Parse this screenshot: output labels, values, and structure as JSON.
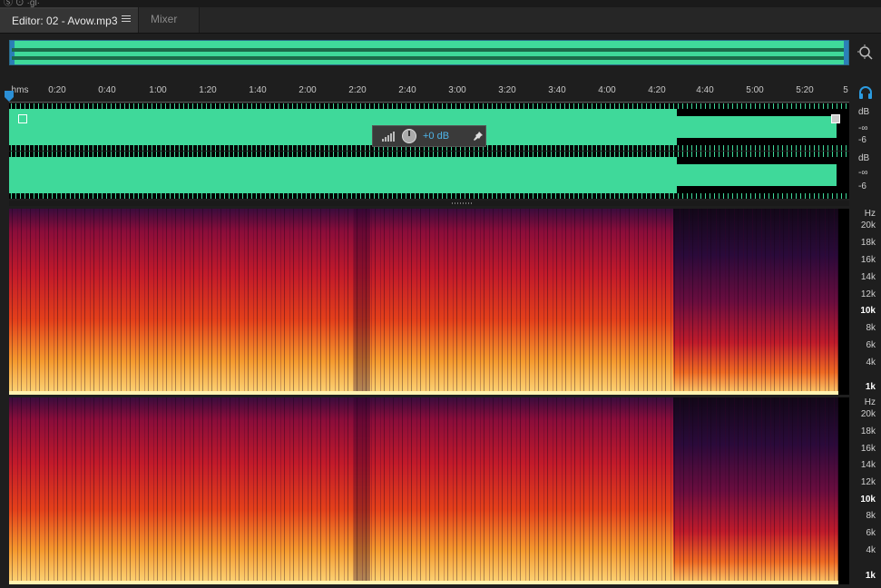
{
  "window": {
    "top_fragment": "Ⓢ ⊙ ·gl·"
  },
  "tabs": [
    {
      "label": "Editor: 02 - Avow.mp3",
      "active": true
    },
    {
      "label": "Mixer",
      "active": false
    }
  ],
  "ruler": {
    "unit": "hms",
    "ticks": [
      "0:20",
      "0:40",
      "1:00",
      "1:20",
      "1:40",
      "2:00",
      "2:20",
      "2:40",
      "3:00",
      "3:20",
      "3:40",
      "4:00",
      "4:20",
      "4:40",
      "5:00",
      "5:20",
      "5"
    ]
  },
  "gain_hud": {
    "value": "+0 dB"
  },
  "waveform": {
    "color": "#3fd99a",
    "channels": [
      {
        "db_unit": "dB",
        "db_labels": [
          "-∞",
          "-6"
        ]
      },
      {
        "db_unit": "dB",
        "db_labels": [
          "-∞",
          "-6"
        ]
      }
    ]
  },
  "spectrogram": {
    "channels": [
      {
        "unit": "Hz",
        "labels": [
          "20k",
          "18k",
          "16k",
          "14k",
          "12k",
          "10k",
          "8k",
          "6k",
          "4k",
          "1k"
        ]
      },
      {
        "unit": "Hz",
        "labels": [
          "20k",
          "18k",
          "16k",
          "14k",
          "12k",
          "10k",
          "8k",
          "6k",
          "4k",
          "1k"
        ]
      }
    ]
  },
  "icons": [
    "tab-menu-icon",
    "zoom-icon",
    "headphones-icon",
    "playhead-icon",
    "pin-icon",
    "gain-bars-icon",
    "gain-knob-icon"
  ]
}
